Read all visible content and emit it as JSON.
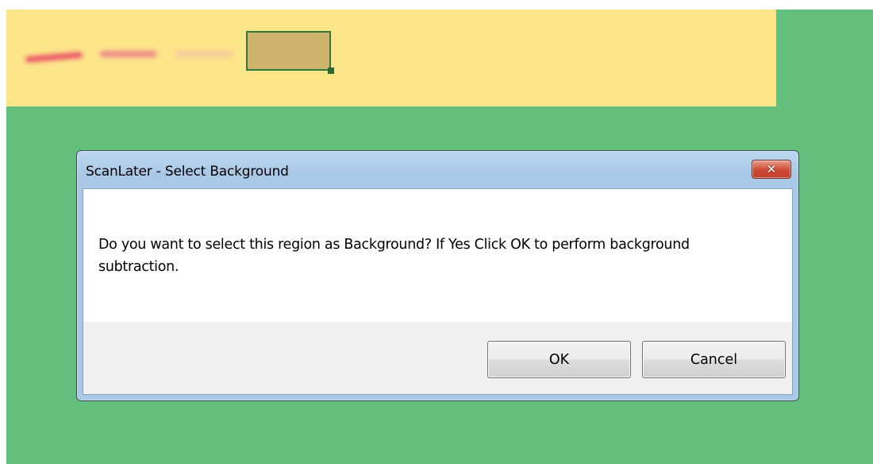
{
  "dialog": {
    "title": "ScanLater - Select Background",
    "close_icon": "close-icon",
    "close_glyph": "✕",
    "message": "Do you want to select this region as Background? If Yes Click OK to perform background subtraction.",
    "ok_label": "OK",
    "cancel_label": "Cancel"
  },
  "colors": {
    "canvas_background": "#63bf7b",
    "image_strip": "#fde58a",
    "selection_border": "#2f7a3a",
    "close_button": "#cc4a35",
    "title_bar": "#a9c8e6"
  }
}
